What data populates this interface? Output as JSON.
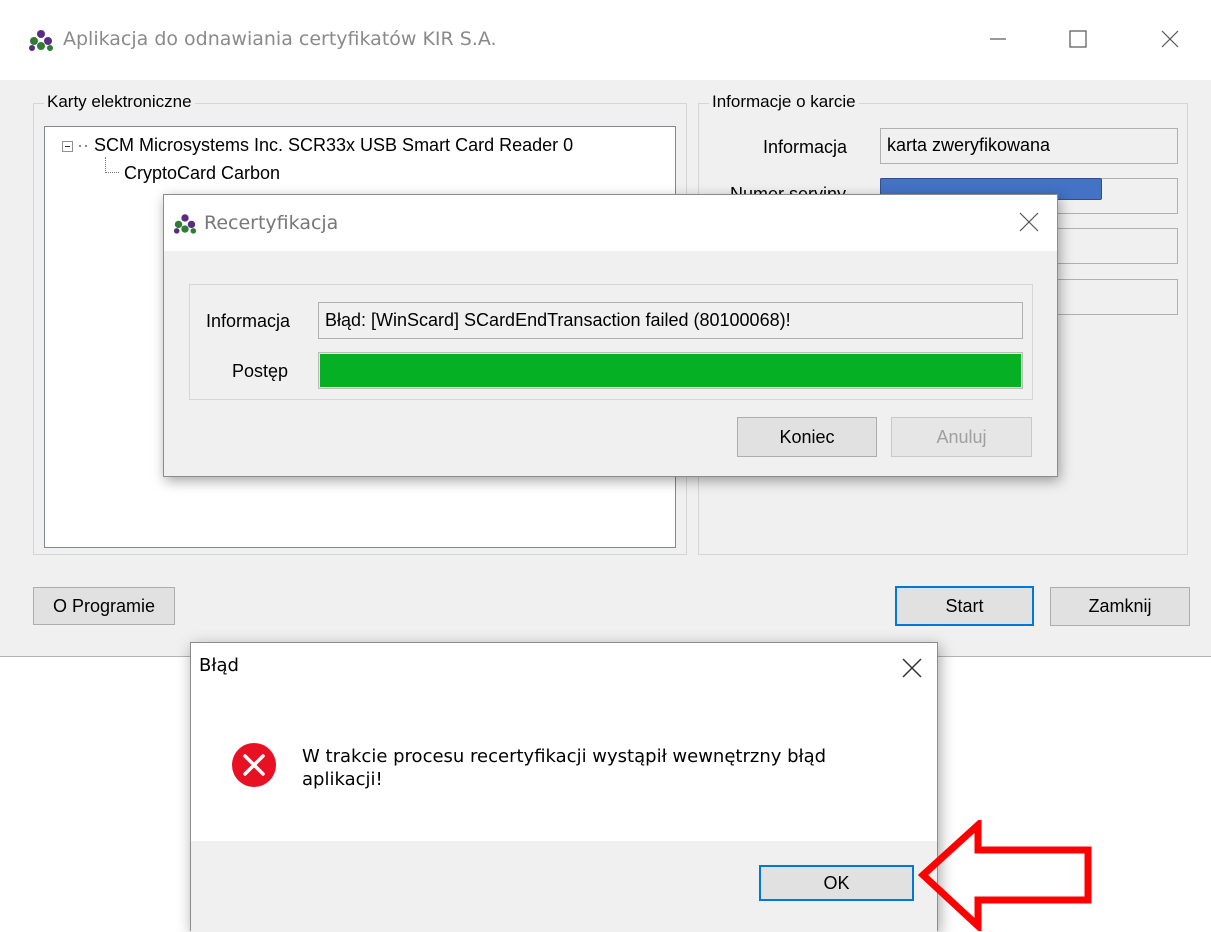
{
  "main_window": {
    "title": "Aplikacja do odnawiania certyfikatów KIR S.A.",
    "cards_group_label": "Karty elektroniczne",
    "tree": {
      "root_label": "SCM Microsystems Inc. SCR33x USB Smart Card Reader 0",
      "child_label": "CryptoCard Carbon"
    },
    "card_info_group_label": "Informacje o karcie",
    "info_label": "Informacja",
    "info_value": "karta zweryfikowana",
    "serial_label": "Numer seryjny",
    "about_button": "O Programie",
    "start_button": "Start",
    "close_button": "Zamknij"
  },
  "recert_dialog": {
    "title": "Recertyfikacja",
    "info_label": "Informacja",
    "info_value": "Błąd: [WinScard] SCardEndTransaction failed (80100068)!",
    "progress_label": "Postęp",
    "progress_fraction": 1.0,
    "finish_button": "Koniec",
    "cancel_button": "Anuluj"
  },
  "error_dialog": {
    "title": "Błąd",
    "message": "W trakcie procesu recertyfikacji wystąpił wewnętrzny błąd aplikacji!",
    "ok_button": "OK"
  },
  "colors": {
    "progress": "#06b025",
    "error_icon": "#e81123",
    "annotation_arrow": "#ff0000",
    "redaction": "#4472c4",
    "focus_border": "#0078d7"
  },
  "icons": {
    "app": "kir-app-icon",
    "error": "error-x-icon",
    "annotation": "red-arrow-annotation"
  }
}
